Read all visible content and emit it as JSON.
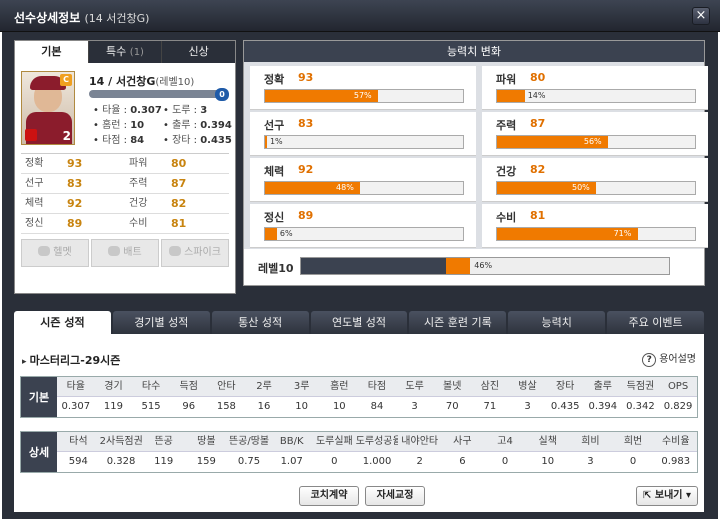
{
  "window": {
    "title": "선수상세정보",
    "title_sub": "(14 서건창G)",
    "close_label": "×"
  },
  "left_tabs": [
    {
      "label": "기본",
      "count": ""
    },
    {
      "label": "특수",
      "count": "(1)"
    },
    {
      "label": "신상",
      "count": ""
    }
  ],
  "player": {
    "name": "14 / 서건창G",
    "level": "(레벨10)",
    "card_badge": "C",
    "card_number": "2",
    "pot_badge": "0",
    "mini_stats": [
      [
        {
          "k": "타율",
          "v": "0.307"
        },
        {
          "k": "도루",
          "v": "3"
        }
      ],
      [
        {
          "k": "홈런",
          "v": "10"
        },
        {
          "k": "출루",
          "v": "0.394"
        }
      ],
      [
        {
          "k": "타점",
          "v": "84"
        },
        {
          "k": "장타",
          "v": "0.435"
        }
      ]
    ],
    "abilities": [
      [
        {
          "k": "정확",
          "v": "93"
        },
        {
          "k": "파워",
          "v": "80"
        }
      ],
      [
        {
          "k": "선구",
          "v": "83"
        },
        {
          "k": "주력",
          "v": "87"
        }
      ],
      [
        {
          "k": "체력",
          "v": "92"
        },
        {
          "k": "건강",
          "v": "82"
        }
      ],
      [
        {
          "k": "정신",
          "v": "89"
        },
        {
          "k": "수비",
          "v": "81"
        }
      ]
    ],
    "equipment": [
      "헬멧",
      "배트",
      "스파이크"
    ]
  },
  "ability_change": {
    "title": "능력치 변화",
    "items": [
      {
        "k": "정확",
        "v": "93",
        "pct": 57,
        "pct_label": "57%"
      },
      {
        "k": "파워",
        "v": "80",
        "pct": 14,
        "pct_label": "14%"
      },
      {
        "k": "선구",
        "v": "83",
        "pct": 1,
        "pct_label": "1%"
      },
      {
        "k": "주력",
        "v": "87",
        "pct": 56,
        "pct_label": "56%"
      },
      {
        "k": "체력",
        "v": "92",
        "pct": 48,
        "pct_label": "48%"
      },
      {
        "k": "건강",
        "v": "82",
        "pct": 50,
        "pct_label": "50%"
      },
      {
        "k": "정신",
        "v": "89",
        "pct": 6,
        "pct_label": "6%"
      },
      {
        "k": "수비",
        "v": "81",
        "pct": 71,
        "pct_label": "71%"
      }
    ],
    "level_label": "레벨10",
    "level_pct": 46,
    "level_pct_label": "46%"
  },
  "bottom_tabs": [
    "시즌 성적",
    "경기별 성적",
    "통산 성적",
    "연도별 성적",
    "시즌 훈련 기록",
    "능력치",
    "주요 이벤트"
  ],
  "season": {
    "title": "마스터리그-29시즌",
    "help_label": "용어설명",
    "basic": {
      "label": "기본",
      "headers": [
        "타율",
        "경기",
        "타수",
        "득점",
        "안타",
        "2루",
        "3루",
        "홈런",
        "타점",
        "도루",
        "볼넷",
        "삼진",
        "병살",
        "장타",
        "출루",
        "득점권",
        "OPS"
      ],
      "values": [
        "0.307",
        "119",
        "515",
        "96",
        "158",
        "16",
        "10",
        "10",
        "84",
        "3",
        "70",
        "71",
        "3",
        "0.435",
        "0.394",
        "0.342",
        "0.829"
      ]
    },
    "detail": {
      "label": "상세",
      "headers": [
        "타석",
        "2사득점권",
        "뜬공",
        "땅볼",
        "뜬공/땅볼",
        "BB/K",
        "도루실패",
        "도루성공율",
        "내야안타",
        "사구",
        "고4",
        "실책",
        "희비",
        "희번",
        "수비율"
      ],
      "values": [
        "594",
        "0.328",
        "119",
        "159",
        "0.75",
        "1.07",
        "0",
        "1.000",
        "2",
        "6",
        "0",
        "10",
        "3",
        "0",
        "0.983"
      ]
    },
    "buttons": {
      "coach": "코치계약",
      "posture": "자세교정",
      "send": "보내기"
    }
  }
}
